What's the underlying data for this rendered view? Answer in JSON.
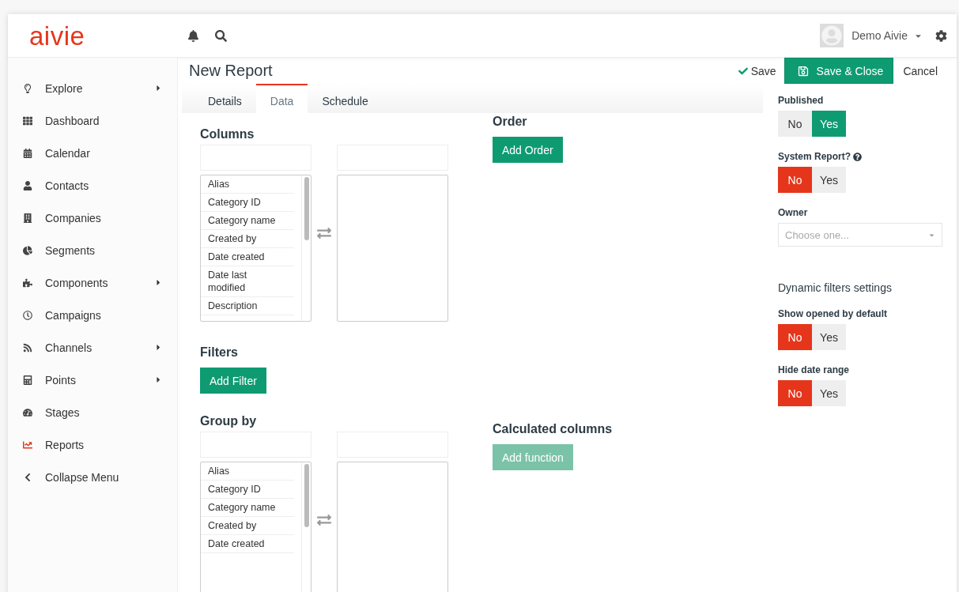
{
  "logo": "aivie",
  "header": {
    "user": {
      "name": "Demo Aivie"
    }
  },
  "sidebar": {
    "items": [
      {
        "label": "Explore",
        "has_submenu": true,
        "selected": false
      },
      {
        "label": "Dashboard",
        "has_submenu": false,
        "selected": false
      },
      {
        "label": "Calendar",
        "has_submenu": false,
        "selected": false
      },
      {
        "label": "Contacts",
        "has_submenu": false,
        "selected": false
      },
      {
        "label": "Companies",
        "has_submenu": false,
        "selected": false
      },
      {
        "label": "Segments",
        "has_submenu": false,
        "selected": false
      },
      {
        "label": "Components",
        "has_submenu": true,
        "selected": false
      },
      {
        "label": "Campaigns",
        "has_submenu": false,
        "selected": false
      },
      {
        "label": "Channels",
        "has_submenu": true,
        "selected": false
      },
      {
        "label": "Points",
        "has_submenu": true,
        "selected": false
      },
      {
        "label": "Stages",
        "has_submenu": false,
        "selected": false
      },
      {
        "label": "Reports",
        "has_submenu": false,
        "selected": true
      },
      {
        "label": "Collapse Menu",
        "has_submenu": false,
        "selected": false
      }
    ]
  },
  "page": {
    "title": "New Report",
    "actions": {
      "save": "Save",
      "save_close": "Save & Close",
      "cancel": "Cancel"
    }
  },
  "tabs": [
    {
      "label": "Details",
      "selected": false
    },
    {
      "label": "Data",
      "selected": true
    },
    {
      "label": "Schedule",
      "selected": false
    }
  ],
  "columns": {
    "title": "Columns",
    "available": [
      "Alias",
      "Category ID",
      "Category name",
      "Created by",
      "Date created",
      "Date last modified",
      "Description"
    ]
  },
  "order": {
    "title": "Order",
    "button": "Add Order"
  },
  "filters": {
    "title": "Filters",
    "button": "Add Filter"
  },
  "group_by": {
    "title": "Group by",
    "available": [
      "Alias",
      "Category ID",
      "Category name",
      "Created by",
      "Date created"
    ]
  },
  "calculated": {
    "title": "Calculated columns",
    "button": "Add function",
    "disabled": true
  },
  "settings": {
    "published": {
      "label": "Published",
      "options": [
        {
          "label": "No",
          "kind": "no",
          "selected": false
        },
        {
          "label": "Yes",
          "kind": "yes",
          "selected": true
        }
      ]
    },
    "system_report": {
      "label": "System Report?",
      "options": [
        {
          "label": "No",
          "kind": "no",
          "selected": true
        },
        {
          "label": "Yes",
          "kind": "yes",
          "selected": false
        }
      ]
    },
    "owner": {
      "label": "Owner",
      "placeholder": "Choose one..."
    },
    "dynamic_title": "Dynamic filters settings",
    "dynamic": [
      {
        "label": "Show opened by default",
        "options": [
          {
            "label": "No",
            "kind": "no",
            "selected": true
          },
          {
            "label": "Yes",
            "kind": "yes",
            "selected": false
          }
        ]
      },
      {
        "label": "Hide date range",
        "options": [
          {
            "label": "No",
            "kind": "no",
            "selected": true
          },
          {
            "label": "Yes",
            "kind": "yes",
            "selected": false
          }
        ]
      }
    ]
  }
}
